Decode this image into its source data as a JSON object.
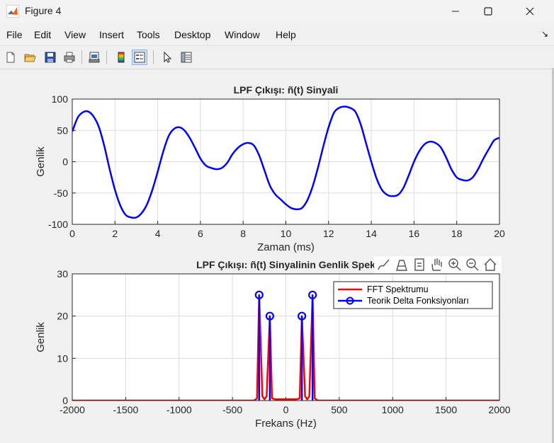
{
  "window": {
    "title": "Figure 4",
    "minimize_glyph": "—",
    "maximize_glyph": "☐",
    "close_glyph": "✕"
  },
  "menu": {
    "items": [
      "File",
      "Edit",
      "View",
      "Insert",
      "Tools",
      "Desktop",
      "Window",
      "Help"
    ],
    "dock_arrow": "↘"
  },
  "toolbar": {
    "icons": [
      "new-figure-icon",
      "open-file-icon",
      "save-icon",
      "print-icon",
      "print-preview-icon",
      "colorbar-icon",
      "legend-icon",
      "pointer-icon",
      "property-inspector-icon"
    ],
    "active": "legend-icon"
  },
  "axes_toolbar": {
    "icons": [
      "brush-icon",
      "data-tips-icon",
      "export-icon",
      "pan-hand-icon",
      "zoom-in-icon",
      "zoom-out-icon",
      "home-icon"
    ]
  },
  "colors": {
    "blue": "#0000ff",
    "red": "#ff0000",
    "grid": "#dcdcdc",
    "axis": "#262626"
  },
  "chart_data": [
    {
      "type": "line",
      "title": "LPF Çıkışı: ñ(t) Sinyali",
      "xlabel": "Zaman (ms)",
      "ylabel": "Genlik",
      "xlim": [
        0,
        20
      ],
      "ylim": [
        -100,
        100
      ],
      "xticks": [
        0,
        2,
        4,
        6,
        8,
        10,
        12,
        14,
        16,
        18,
        20
      ],
      "yticks": [
        -100,
        -50,
        0,
        50,
        100
      ],
      "grid": true,
      "legend": "none",
      "series": [
        {
          "color": "#0000ff",
          "x": [
            0,
            0.25,
            0.5,
            0.75,
            1.0,
            1.25,
            1.5,
            1.75,
            2.0,
            2.25,
            2.5,
            2.75,
            3.0,
            3.25,
            3.5,
            3.75,
            4.0,
            4.25,
            4.5,
            4.75,
            5.0,
            5.25,
            5.5,
            5.75,
            6.0,
            6.25,
            6.5,
            6.75,
            7.0,
            7.25,
            7.5,
            7.75,
            8.0,
            8.25,
            8.5,
            8.75,
            9.0,
            9.25,
            9.5,
            9.75,
            10.0,
            10.25,
            10.5,
            10.75,
            11.0,
            11.25,
            11.5,
            11.75,
            12.0,
            12.25,
            12.5,
            12.75,
            13.0,
            13.25,
            13.5,
            13.75,
            14.0,
            14.25,
            14.5,
            14.75,
            15.0,
            15.25,
            15.5,
            15.75,
            16.0,
            16.25,
            16.5,
            16.75,
            17.0,
            17.25,
            17.5,
            17.75,
            18.0,
            18.25,
            18.5,
            18.75,
            19.0,
            19.25,
            19.5,
            19.75,
            20.0
          ],
          "y": [
            48,
            70,
            79,
            80,
            72,
            55,
            25,
            -12,
            -45,
            -70,
            -85,
            -89,
            -89,
            -82,
            -68,
            -45,
            -16,
            15,
            40,
            52,
            55,
            50,
            38,
            22,
            5,
            -6,
            -10,
            -12,
            -10,
            -2,
            12,
            22,
            28,
            30,
            26,
            10,
            -14,
            -38,
            -52,
            -60,
            -68,
            -74,
            -76,
            -74,
            -62,
            -40,
            -10,
            24,
            55,
            78,
            86,
            88,
            86,
            80,
            60,
            30,
            0,
            -27,
            -45,
            -53,
            -55,
            -53,
            -42,
            -22,
            0,
            17,
            28,
            32,
            30,
            23,
            7,
            -12,
            -25,
            -29,
            -30,
            -25,
            -12,
            5,
            20,
            34,
            38
          ]
        }
      ]
    },
    {
      "type": "line",
      "title": "LPF Çıkışı: ñ(t) Sinyalinin Genlik Spek",
      "xlabel": "Frekans (Hz)",
      "ylabel": "Genlik",
      "xlim": [
        -2000,
        2000
      ],
      "ylim": [
        0,
        30
      ],
      "xticks": [
        -2000,
        -1500,
        -1000,
        -500,
        0,
        500,
        1000,
        1500,
        2000
      ],
      "yticks": [
        0,
        10,
        20,
        30
      ],
      "grid": true,
      "legend": "top-right",
      "series": [
        {
          "name": "FFT Spektrumu",
          "color": "#ff0000",
          "x": [
            -2000,
            -300,
            -270,
            -250,
            -220,
            -200,
            -180,
            -150,
            -130,
            -100,
            100,
            130,
            150,
            180,
            200,
            220,
            250,
            270,
            300,
            2000
          ],
          "y": [
            0,
            0,
            0.5,
            25,
            1,
            0.3,
            1,
            20,
            0.5,
            0.3,
            0.3,
            0.5,
            20,
            1,
            0.3,
            1,
            25,
            0.5,
            0,
            0
          ]
        },
        {
          "name": "Teorik Delta Fonksiyonları",
          "color": "#0000ff",
          "stems": [
            {
              "x": -250,
              "y": 25
            },
            {
              "x": -150,
              "y": 20
            },
            {
              "x": 150,
              "y": 20
            },
            {
              "x": 250,
              "y": 25
            }
          ]
        }
      ]
    }
  ]
}
